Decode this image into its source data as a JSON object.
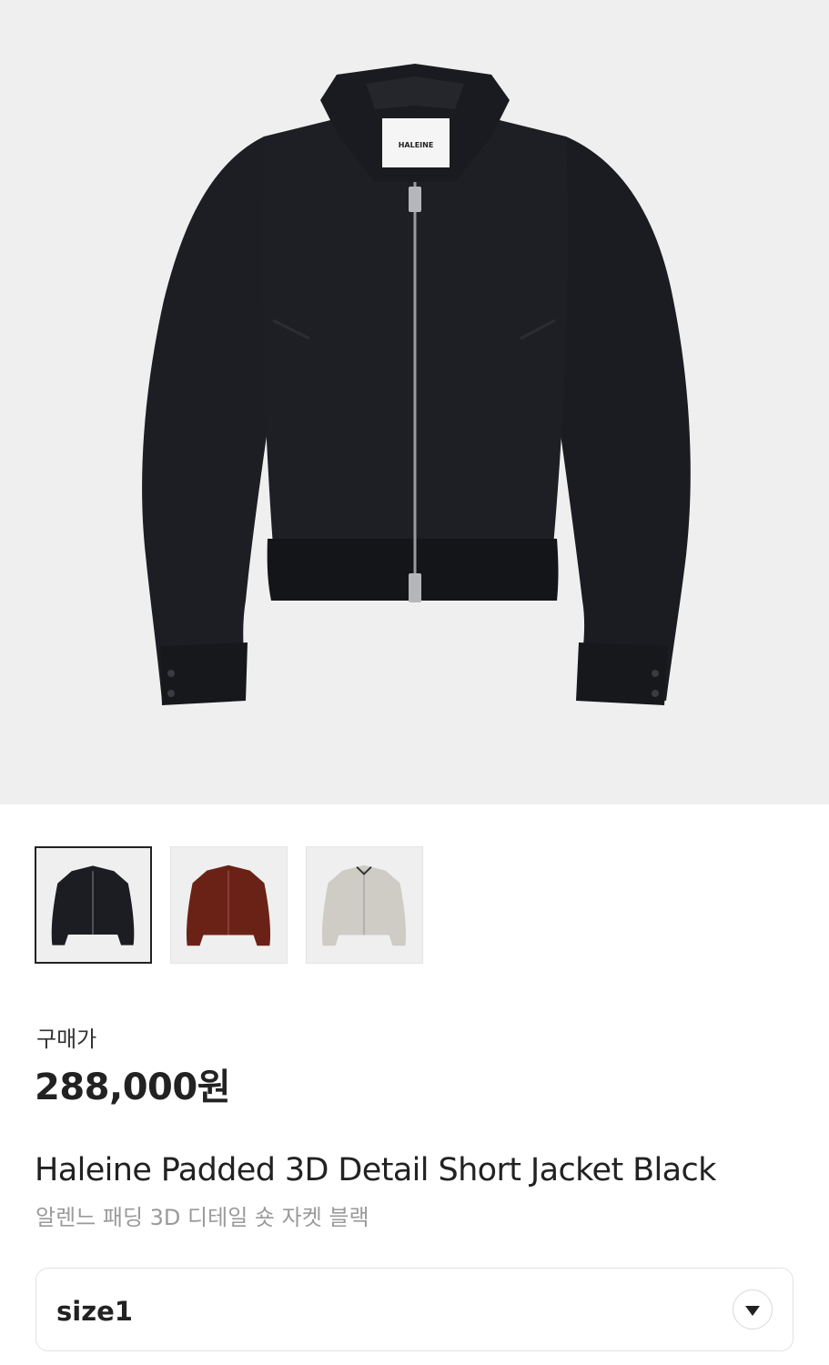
{
  "product": {
    "hero_icon": "jacket-photo",
    "brand_label": "HALEINE",
    "thumbnails": [
      {
        "color_name": "black",
        "color": "#1c1d22",
        "selected": true
      },
      {
        "color_name": "burgundy",
        "color": "#6b2216",
        "selected": false
      },
      {
        "color_name": "light-gray",
        "color": "#cfcbc5",
        "selected": false
      }
    ],
    "price_label": "구매가",
    "price": "288,000원",
    "title_en": "Haleine Padded 3D Detail Short Jacket Black",
    "title_ko": "알렌느 패딩 3D 디테일 숏 자켓 블랙",
    "size": {
      "selected": "size1",
      "dropdown_icon": "chevron-down-icon"
    }
  }
}
